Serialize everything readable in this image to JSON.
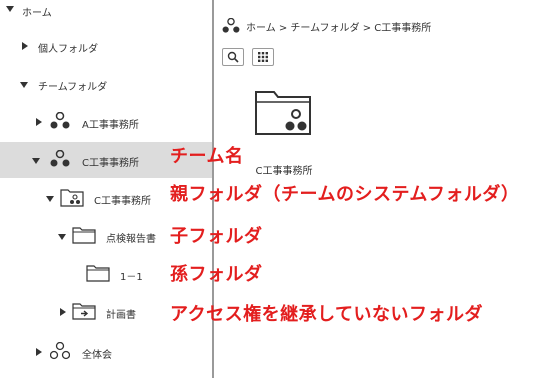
{
  "tree": {
    "home": "ホーム",
    "personal": "個人フォルダ",
    "team": "チームフォルダ",
    "team_a": "A工事事務所",
    "team_c": "C工事事務所",
    "c_folder": "C工事事務所",
    "inspection": "点検報告書",
    "sub": "1－1",
    "plan": "計画書",
    "all": "全体会"
  },
  "breadcrumb": {
    "text": "ホーム > チームフォルダ > C工事事務所"
  },
  "toolbar": {
    "search_icon": "search-icon",
    "grid_icon": "grid-icon"
  },
  "content": {
    "tile_label": "C工事事務所"
  },
  "annotations": {
    "team_name": "チーム名",
    "parent": "親フォルダ（チームのシステムフォルダ）",
    "child": "子フォルダ",
    "grandchild": "孫フォルダ",
    "no_inherit": "アクセス権を継承していないフォルダ"
  },
  "colors": {
    "annotation": "#e31e1e",
    "selected_row": "#dcdcdc",
    "icon": "#333333"
  }
}
